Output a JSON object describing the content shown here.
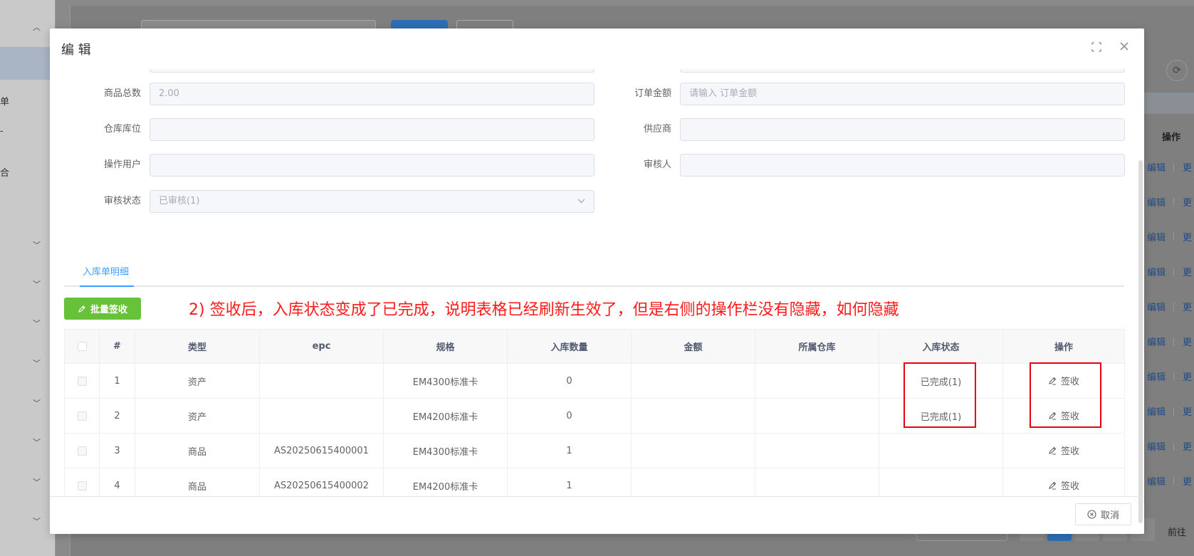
{
  "background": {
    "sidebar_items": [
      "单",
      "合"
    ],
    "op_title": "操作",
    "edit_label": "编辑",
    "more_label": "更",
    "goto_label": "前往"
  },
  "dialog": {
    "title": "编 辑",
    "form": {
      "total_qty": {
        "label": "商品总数",
        "value": "2.00"
      },
      "order_amount": {
        "label": "订单金额",
        "placeholder": "请输入 订单金额"
      },
      "warehouse_loc": {
        "label": "仓库库位",
        "value": ""
      },
      "supplier": {
        "label": "供应商",
        "value": ""
      },
      "operator": {
        "label": "操作用户",
        "value": ""
      },
      "reviewer": {
        "label": "审核人",
        "value": ""
      },
      "review_status": {
        "label": "审核状态",
        "value": "已审核(1)"
      }
    },
    "tab_label": "入库单明细",
    "batch_sign_label": "批量签收",
    "annotation": "2) 签收后，入库状态变成了已完成，说明表格已经刷新生效了，但是右侧的操作栏没有隐藏，如何隐藏",
    "table": {
      "headers": [
        "#",
        "类型",
        "epc",
        "规格",
        "入库数量",
        "金额",
        "所属仓库",
        "入库状态",
        "操作"
      ],
      "rows": [
        {
          "no": "1",
          "type": "资产",
          "epc": "",
          "spec": "EM4300标准卡",
          "qty": "0",
          "amount": "",
          "warehouse": "",
          "status": "已完成(1)",
          "op": "签收"
        },
        {
          "no": "2",
          "type": "资产",
          "epc": "",
          "spec": "EM4200标准卡",
          "qty": "0",
          "amount": "",
          "warehouse": "",
          "status": "已完成(1)",
          "op": "签收"
        },
        {
          "no": "3",
          "type": "商品",
          "epc": "AS20250615400001",
          "spec": "EM4300标准卡",
          "qty": "1",
          "amount": "",
          "warehouse": "",
          "status": "",
          "op": "签收"
        },
        {
          "no": "4",
          "type": "商品",
          "epc": "AS20250615400002",
          "spec": "EM4200标准卡",
          "qty": "1",
          "amount": "",
          "warehouse": "",
          "status": "",
          "op": "签收"
        }
      ]
    },
    "cancel_label": "取消"
  }
}
